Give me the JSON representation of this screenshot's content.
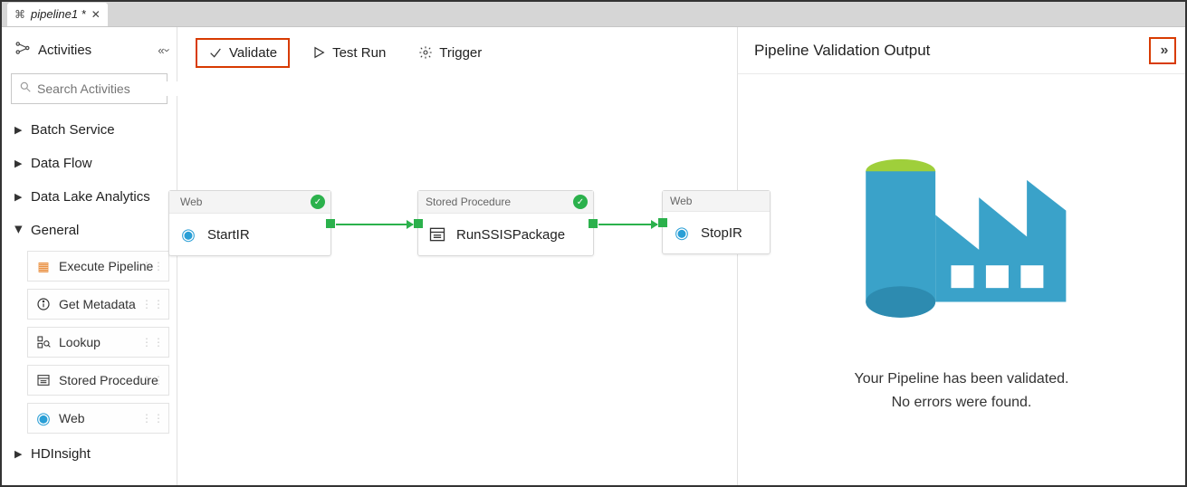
{
  "tab": {
    "label": "pipeline1 *"
  },
  "sidebar": {
    "title": "Activities",
    "search_placeholder": "Search Activities",
    "groups": [
      {
        "label": "Batch Service",
        "expanded": false
      },
      {
        "label": "Data Flow",
        "expanded": false
      },
      {
        "label": "Data Lake Analytics",
        "expanded": false
      },
      {
        "label": "General",
        "expanded": true,
        "items": [
          {
            "label": "Execute Pipeline",
            "icon": "execute-pipeline-icon"
          },
          {
            "label": "Get Metadata",
            "icon": "info-icon"
          },
          {
            "label": "Lookup",
            "icon": "lookup-icon"
          },
          {
            "label": "Stored Procedure",
            "icon": "stored-procedure-icon"
          },
          {
            "label": "Web",
            "icon": "web-icon"
          }
        ]
      },
      {
        "label": "HDInsight",
        "expanded": false
      }
    ]
  },
  "toolbar": {
    "validate": "Validate",
    "testrun": "Test Run",
    "trigger": "Trigger"
  },
  "canvas": {
    "activities": [
      {
        "type": "Web",
        "name": "StartIR",
        "status": "success"
      },
      {
        "type": "Stored Procedure",
        "name": "RunSSISPackage",
        "status": "success"
      },
      {
        "type": "Web",
        "name": "StopIR",
        "status": "none"
      }
    ]
  },
  "panel": {
    "title": "Pipeline Validation Output",
    "message_line1": "Your Pipeline has been validated.",
    "message_line2": "No errors were found."
  },
  "colors": {
    "accent_green": "#2bb14c",
    "highlight": "#d83b01",
    "blue": "#2a9fd6",
    "teal": "#2db0c4"
  }
}
